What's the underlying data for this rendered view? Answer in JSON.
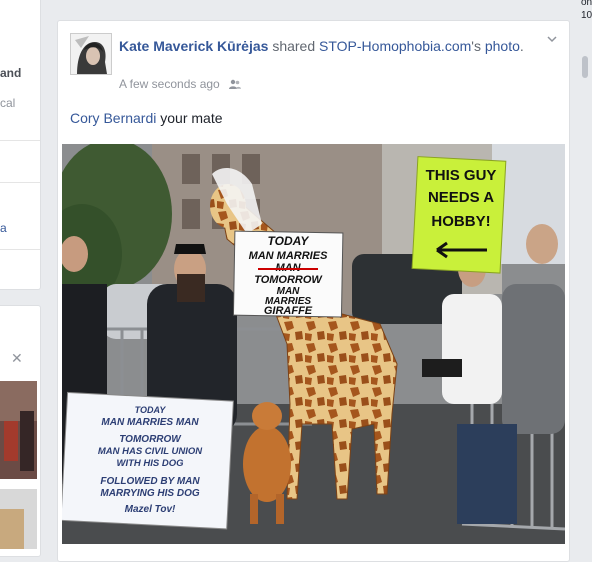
{
  "left_panel": {
    "items": [
      {
        "text": "and"
      },
      {
        "text": "cal"
      },
      {
        "text": "a"
      }
    ],
    "close_glyph": "✕"
  },
  "right_panel": {
    "lines": [
      "on",
      "10"
    ]
  },
  "post": {
    "author": "Kate Maverick Kūrėjas",
    "action_text": "shared",
    "shared_page": "STOP-Homophobia.com",
    "possessive": "'s",
    "object": "photo",
    "object_suffix": ".",
    "timestamp": "A few seconds ago",
    "audience_icon": "friends-icon",
    "text_mention": "Cory Bernardi",
    "text_rest": " your mate",
    "photo": {
      "sign_center_lines": [
        "TODAY",
        "MAN MARRIES",
        "MAN",
        "TOMORROW",
        "MAN",
        "MARRIES",
        "GIRAFFE"
      ],
      "sign_right_lines": [
        "THIS GUY",
        "NEEDS A",
        "HOBBY!"
      ],
      "sign_left_lines": [
        "TODAY",
        "MAN MARRIES MAN",
        "TOMORROW",
        "MAN HAS CIVIL UNION",
        "WITH HIS DOG",
        "FOLLOWED BY MAN",
        "MARRYING HIS DOG",
        "Mazel Tov!"
      ]
    }
  },
  "colors": {
    "link": "#365899",
    "page_bg": "#e9ebee",
    "sign_green": "#c9f03a"
  }
}
